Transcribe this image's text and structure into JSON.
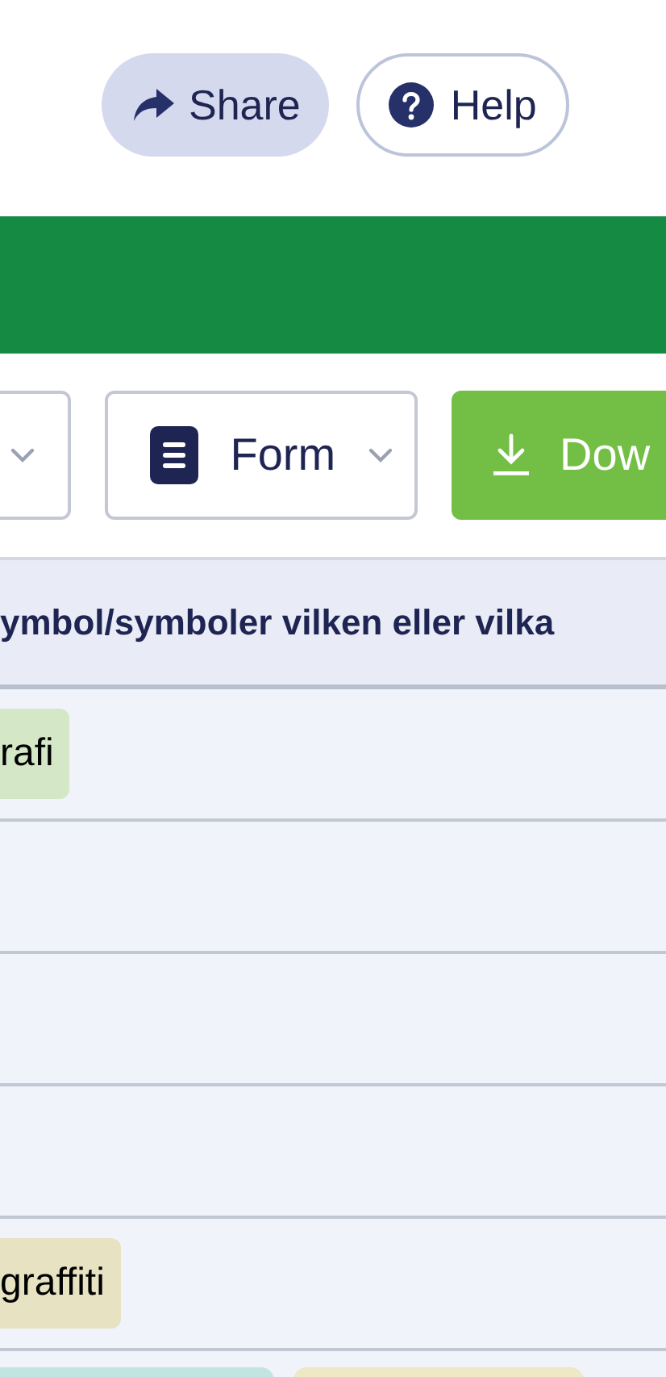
{
  "header_buttons": [
    {
      "kind": "share",
      "label": "Share"
    },
    {
      "kind": "help",
      "label": "Help"
    }
  ],
  "toolbar": {
    "dropdowns": [
      {
        "kind": "plain"
      },
      {
        "kind": "form",
        "label": "Form"
      }
    ],
    "download": {
      "label": "Dow"
    }
  },
  "table": {
    "column_header": "ymbol/symboler vilken eller vilka",
    "rows": [
      {
        "tags": [
          {
            "label": "rafi",
            "color": "#d4e8c8"
          }
        ]
      },
      {
        "tags": []
      },
      {
        "tags": []
      },
      {
        "tags": []
      },
      {
        "tags": [
          {
            "label": "graffiti",
            "color": "#e7e3c2"
          }
        ]
      },
      {
        "tags": [
          {
            "color": "#c2e5e4"
          },
          {
            "color": "#efe8c4"
          }
        ]
      }
    ]
  }
}
